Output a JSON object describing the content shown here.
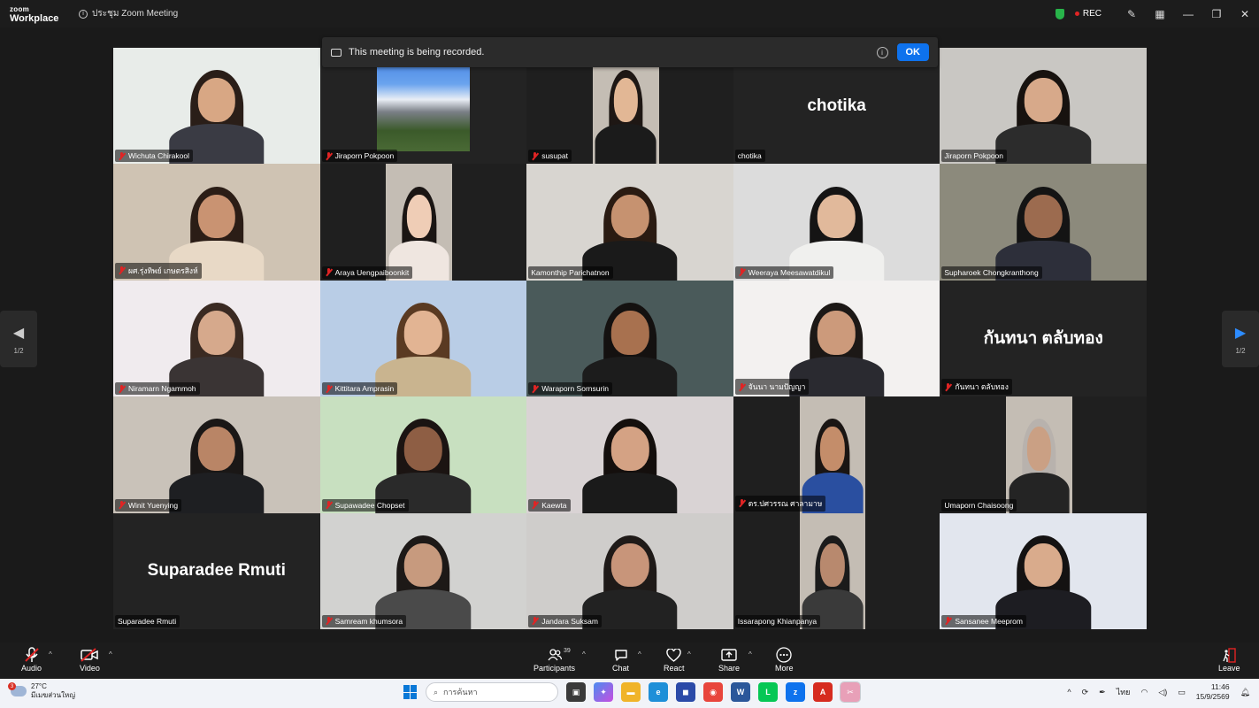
{
  "titlebar": {
    "logo_top": "zoom",
    "logo_bottom": "Workplace",
    "meeting_title": "ประชุม Zoom Meeting",
    "rec_label": "REC"
  },
  "banner": {
    "text": "This meeting is being recorded.",
    "ok_label": "OK"
  },
  "pager": {
    "left_page": "1/2",
    "right_page": "1/2"
  },
  "tiles": [
    {
      "name": "Wichuta Chirakool",
      "muted": true,
      "kind": "video",
      "bg": "#e8ece9",
      "skin": "#d8a784",
      "hair": "#2a1e18",
      "shirt": "#3a3b44"
    },
    {
      "name": "Jiraporn Pokpoon",
      "muted": true,
      "kind": "photo",
      "bg": "#1f1f1f"
    },
    {
      "name": "susupat",
      "muted": true,
      "kind": "framed",
      "bg": "#1f1f1f",
      "skin": "#e2b795",
      "hair": "#1e1714",
      "shirt": "#1b1b1b"
    },
    {
      "name": "chotika",
      "muted": false,
      "kind": "text",
      "big": "chotika"
    },
    {
      "name": "Jiraporn Pokpoon",
      "muted": false,
      "kind": "video",
      "bg": "#c9c7c3",
      "skin": "#d7a98a",
      "hair": "#17120f",
      "shirt": "#2c2c2c"
    },
    {
      "name": "ผศ.รุ่งทิพย์  เกษตรสิงห์",
      "muted": true,
      "kind": "video",
      "bg": "#cfc3b3",
      "skin": "#c99372",
      "hair": "#2b1d16",
      "shirt": "#e8d9c6"
    },
    {
      "name": "Araya Uengpaiboonkit",
      "muted": true,
      "kind": "framed",
      "bg": "#1f1f1f",
      "skin": "#efcdb6",
      "hair": "#1a1513",
      "shirt": "#efe6e0"
    },
    {
      "name": "Kamonthip Parichatnon",
      "muted": false,
      "kind": "video",
      "bg": "#d8d5d0",
      "skin": "#c69270",
      "hair": "#2a1b12",
      "shirt": "#1a1a1a",
      "speaking": true
    },
    {
      "name": "Weeraya Meesawatdikul",
      "muted": true,
      "kind": "video",
      "bg": "#dcdcdc",
      "skin": "#e1b99b",
      "hair": "#151414",
      "shirt": "#f0f0ee"
    },
    {
      "name": "Supharoek Chongkranthong",
      "muted": false,
      "kind": "video",
      "bg": "#8c8a7c",
      "skin": "#9c6b4f",
      "hair": "#141414",
      "shirt": "#2d2f3a"
    },
    {
      "name": "Niramarn Ngammoh",
      "muted": true,
      "kind": "video",
      "bg": "#f0ebee",
      "skin": "#d6a98c",
      "hair": "#3a2a22",
      "shirt": "#3a3434"
    },
    {
      "name": "Kittitara Amprasin",
      "muted": true,
      "kind": "video",
      "bg": "#b9cde6",
      "skin": "#e2b493",
      "hair": "#5a3a22",
      "shirt": "#c9b48f"
    },
    {
      "name": "Waraporn Sornsurin",
      "muted": true,
      "kind": "video",
      "bg": "#4a5a5a",
      "skin": "#a8714f",
      "hair": "#141110",
      "shirt": "#1c1c1c"
    },
    {
      "name": "จันนา นามปัญญา",
      "muted": true,
      "kind": "video",
      "bg": "#f3f1f0",
      "skin": "#cc9a7b",
      "hair": "#1c1816",
      "shirt": "#2a2a30"
    },
    {
      "name": "กันทนา ตลับทอง",
      "muted": true,
      "kind": "text",
      "big": "กันทนา ตลับทอง"
    },
    {
      "name": "Winit Yuenying",
      "muted": true,
      "kind": "video",
      "bg": "#c9c2b9",
      "skin": "#b98566",
      "hair": "#1a1716",
      "shirt": "#1e1f22"
    },
    {
      "name": "Supawadee Chopset",
      "muted": true,
      "kind": "video",
      "bg": "#c8e0c0",
      "skin": "#8e5e44",
      "hair": "#1b1412",
      "shirt": "#2a2a2a"
    },
    {
      "name": "Kaewta",
      "muted": true,
      "kind": "video",
      "bg": "#d9d3d4",
      "skin": "#d4a284",
      "hair": "#140f0d",
      "shirt": "#1a1a1a"
    },
    {
      "name": "ดร.ปศวรรณ ศาลามาษ",
      "muted": true,
      "kind": "framed",
      "bg": "#1f1f1f",
      "skin": "#c48d6a",
      "hair": "#1a1513",
      "shirt": "#2a4fa0"
    },
    {
      "name": "Umaporn Chaisoong",
      "muted": false,
      "kind": "framed",
      "bg": "#1f1f1f",
      "skin": "#caa084",
      "hair": "#b8b2ad",
      "shirt": "#242424"
    },
    {
      "name": "Suparadee Rmuti",
      "muted": false,
      "kind": "text",
      "big": "Suparadee Rmuti"
    },
    {
      "name": "Samream khumsora",
      "muted": true,
      "kind": "video",
      "bg": "#d2d2d0",
      "skin": "#c79a7e",
      "hair": "#1d1917",
      "shirt": "#4a4a4a"
    },
    {
      "name": "Jandara Suksam",
      "muted": true,
      "kind": "video",
      "bg": "#cfcdcb",
      "skin": "#c8957a",
      "hair": "#1f1a18",
      "shirt": "#222"
    },
    {
      "name": "Issarapong Khianpanya",
      "muted": false,
      "kind": "framed",
      "bg": "#1f1f1f",
      "skin": "#b8896e",
      "hair": "#1b1b1b",
      "shirt": "#3a3a3a"
    },
    {
      "name": "Sansanee Meeprom",
      "muted": true,
      "kind": "video",
      "bg": "#e2e6ee",
      "skin": "#d9ab8c",
      "hair": "#141212",
      "shirt": "#1d1d22"
    }
  ],
  "toolbar": {
    "audio": "Audio",
    "video": "Video",
    "participants": "Participants",
    "participants_count": "39",
    "chat": "Chat",
    "react": "React",
    "share": "Share",
    "more": "More",
    "leave": "Leave"
  },
  "taskbar": {
    "temperature": "27°C",
    "weather_desc": "มีเมฆส่วนใหญ่",
    "weather_badge": "3",
    "search_placeholder": "การค้นหา",
    "language": "ไทย",
    "time": "11:46",
    "date": "15/9/2569"
  },
  "colors": {
    "accent": "#0e72ed",
    "muted_red": "#e02424",
    "speaking_green": "#3ad36b",
    "shield_green": "#28b44a"
  }
}
